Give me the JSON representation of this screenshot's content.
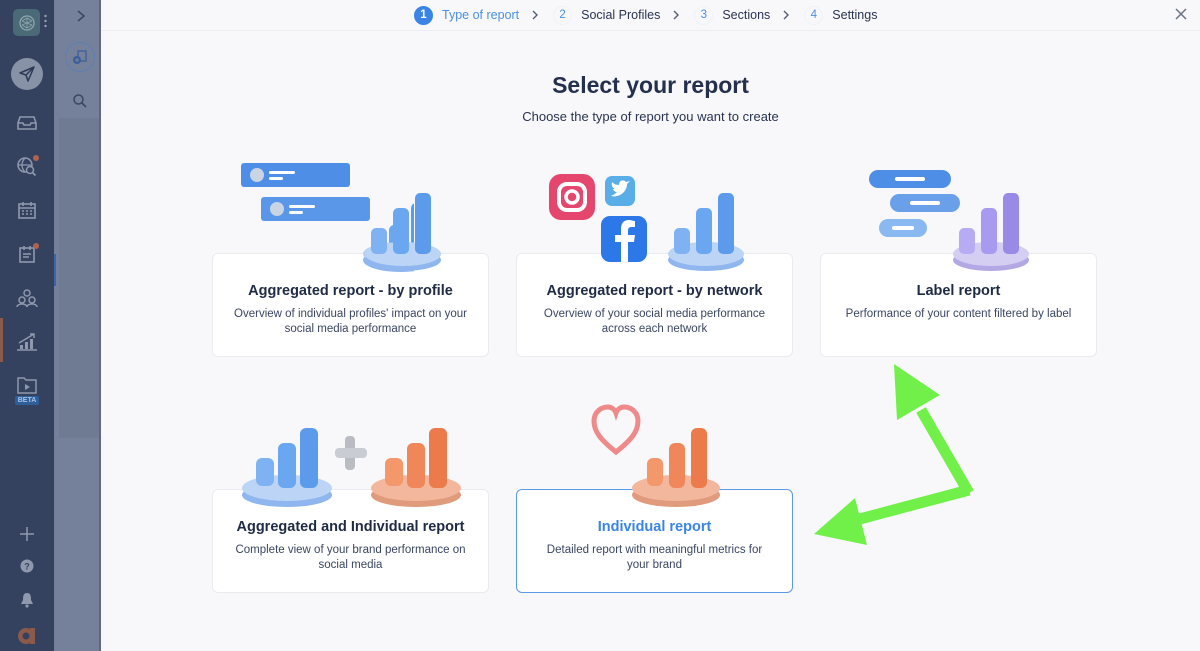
{
  "sidebar": {
    "items": [
      {
        "name": "logo",
        "icon": "brain-logo-icon"
      },
      {
        "name": "publish",
        "icon": "paper-plane-icon"
      },
      {
        "name": "inbox",
        "icon": "inbox-tray-icon"
      },
      {
        "name": "listening",
        "icon": "globe-search-icon",
        "has_notification": true
      },
      {
        "name": "calendar",
        "icon": "calendar-icon"
      },
      {
        "name": "tasks",
        "icon": "clipboard-list-icon",
        "has_notification": true
      },
      {
        "name": "team",
        "icon": "users-group-icon"
      },
      {
        "name": "analytics",
        "icon": "chart-growth-icon",
        "active": true
      },
      {
        "name": "videos",
        "icon": "video-folder-icon",
        "badge": "BETA"
      }
    ],
    "bottom": [
      {
        "name": "add",
        "icon": "plus-icon"
      },
      {
        "name": "help",
        "icon": "question-circle-icon"
      },
      {
        "name": "notifications",
        "icon": "bell-icon"
      },
      {
        "name": "account",
        "icon": "avatar-letter-icon",
        "text": "a"
      }
    ],
    "beta_label": "BETA"
  },
  "subpanel": {
    "expand_icon": "chevron-right-icon",
    "add_report_icon": "add-report-icon",
    "search_icon": "search-icon"
  },
  "stepper": {
    "steps": [
      {
        "number": "1",
        "label": "Type of report",
        "active": true
      },
      {
        "number": "2",
        "label": "Social Profiles",
        "active": false
      },
      {
        "number": "3",
        "label": "Sections",
        "active": false
      },
      {
        "number": "4",
        "label": "Settings",
        "active": false
      }
    ],
    "separator_icon": "chevron-right-icon",
    "close_icon": "close-icon"
  },
  "header": {
    "title": "Select your report",
    "subtitle": "Choose the type of report you want to create"
  },
  "cards": [
    {
      "title": "Aggregated report - by profile",
      "description": "Overview of individual profiles' impact on your social media performance",
      "illustration": "profiles-bar-chart-illustration",
      "selected": false
    },
    {
      "title": "Aggregated report - by network",
      "description": "Overview of your social media performance across each network",
      "illustration": "social-networks-bar-chart-illustration",
      "selected": false
    },
    {
      "title": "Label report",
      "description": "Performance of your content filtered by label",
      "illustration": "labels-bar-chart-illustration",
      "selected": false
    },
    {
      "title": "Aggregated and Individual report",
      "description": "Complete view of your brand performance on social media",
      "illustration": "blue-plus-orange-bar-chart-illustration",
      "selected": false
    },
    {
      "title": "Individual report",
      "description": "Detailed report with meaningful metrics for your brand",
      "illustration": "heart-bar-chart-illustration",
      "selected": true
    }
  ],
  "colors": {
    "accent": "#3a84e6",
    "sidebar_bg": "#34425f",
    "annotation_arrow": "#72f04a",
    "chart_blue": "#6aa7f0",
    "chart_purple": "#a89af0",
    "chart_orange": "#f0875a"
  },
  "annotation": {
    "type": "double-arrow",
    "icon": "green-arrow-annotation"
  }
}
